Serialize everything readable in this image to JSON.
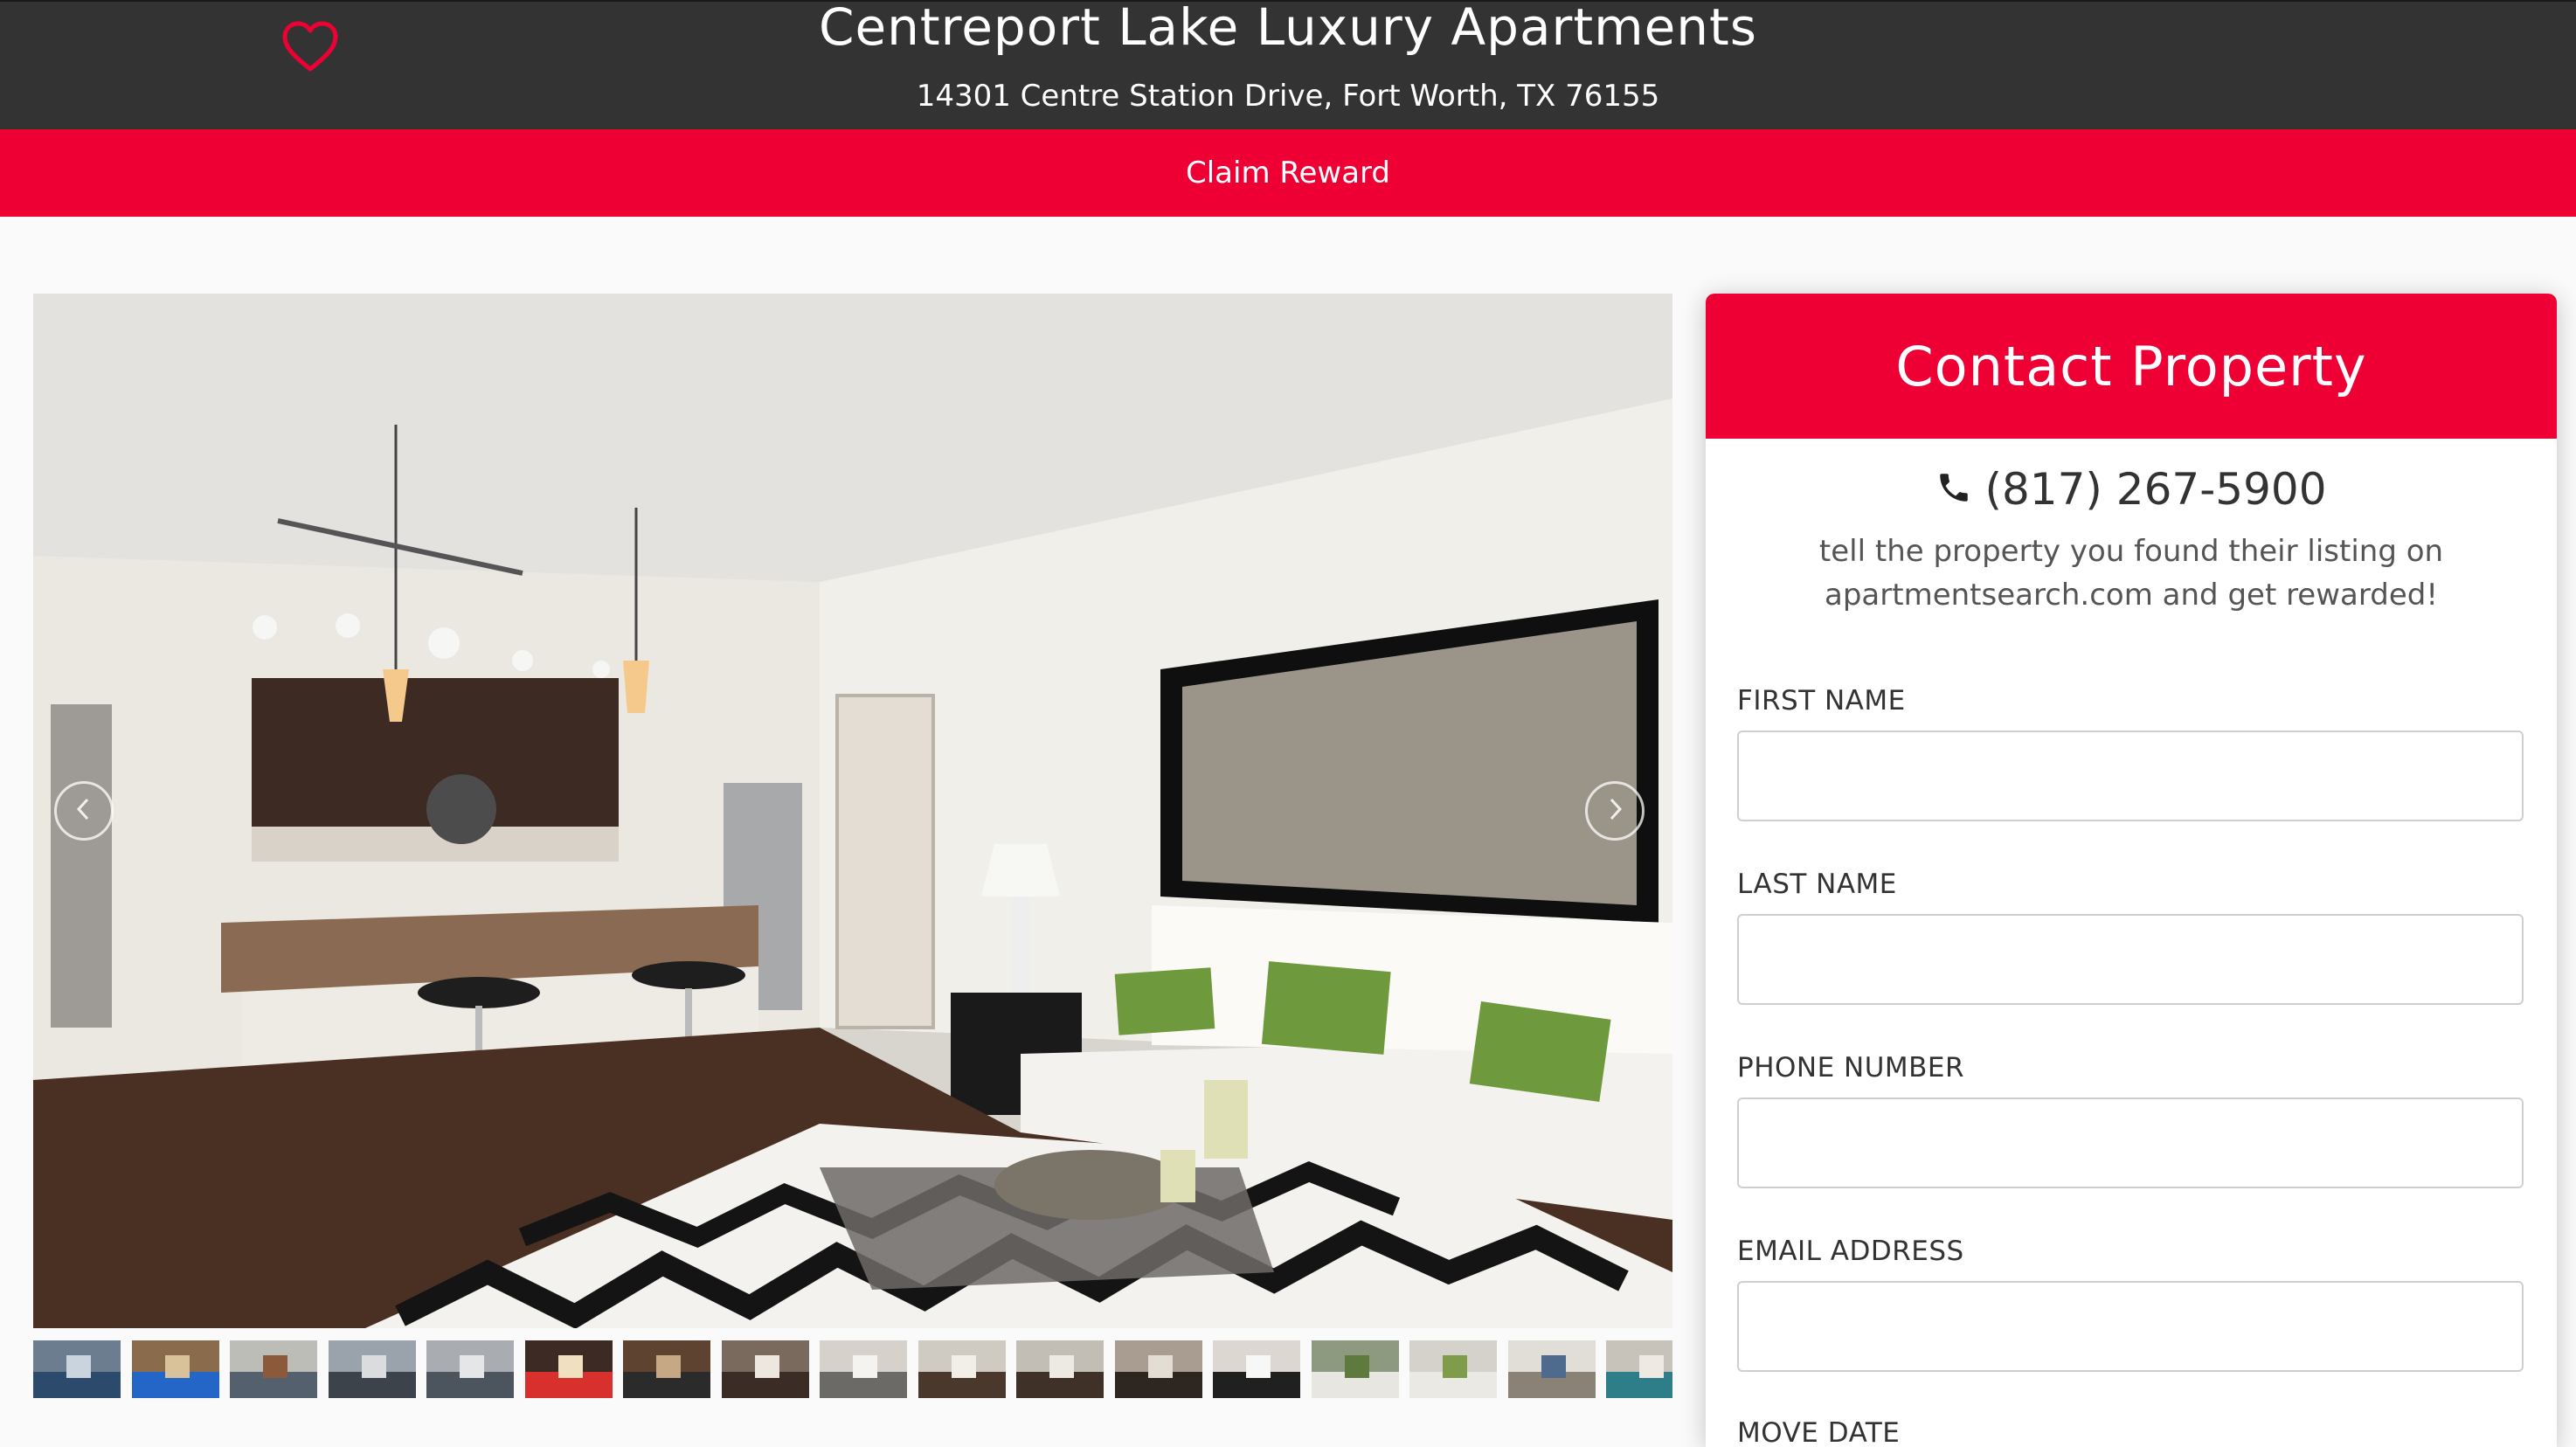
{
  "header": {
    "title": "Centreport Lake Luxury Apartments",
    "address": "14301 Centre Station Drive, Fort Worth, TX 76155",
    "favorite_icon": "heart-outline-icon"
  },
  "claim_bar": {
    "label": "Claim Reward"
  },
  "gallery": {
    "prev_icon": "chevron-left-icon",
    "next_icon": "chevron-right-icon",
    "thumbnail_count": 17
  },
  "contact": {
    "title": "Contact Property",
    "phone_icon": "phone-icon",
    "phone": "(817) 267-5900",
    "reward_message": "tell the property you found their listing on apartmentsearch.com and get rewarded!",
    "fields": [
      {
        "label": "FIRST NAME",
        "value": "",
        "placeholder": ""
      },
      {
        "label": "LAST NAME",
        "value": "",
        "placeholder": ""
      },
      {
        "label": "PHONE NUMBER",
        "value": "",
        "placeholder": ""
      },
      {
        "label": "EMAIL ADDRESS",
        "value": "",
        "placeholder": ""
      },
      {
        "label": "MOVE DATE",
        "value": "",
        "placeholder": ""
      }
    ]
  },
  "colors": {
    "header_bg": "#333333",
    "accent_red": "#ee0035",
    "page_bg": "#fafafa"
  }
}
